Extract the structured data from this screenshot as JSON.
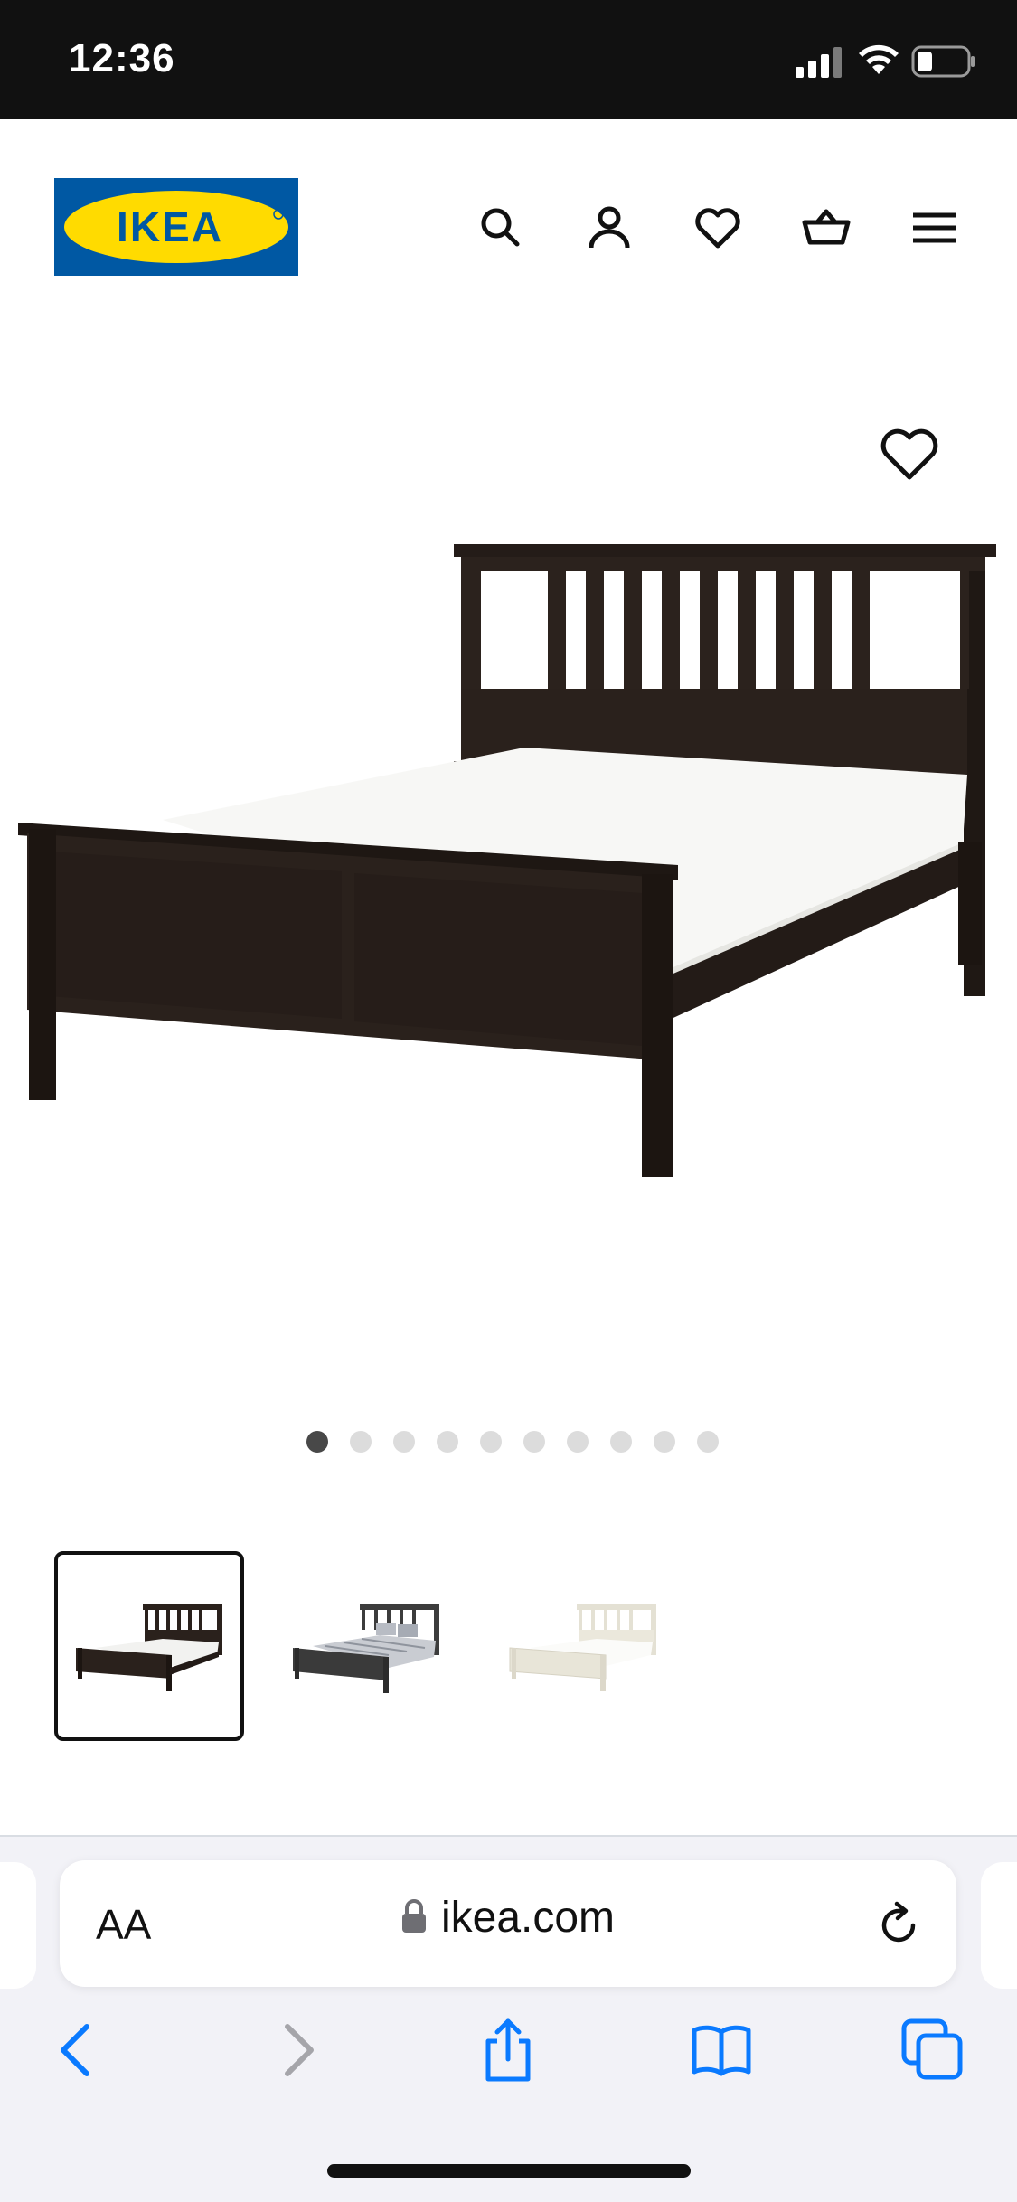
{
  "status_bar": {
    "time": "12:36",
    "icons": [
      "cellular-signal-icon",
      "wifi-icon",
      "battery-icon"
    ]
  },
  "header": {
    "logo_text": "IKEA",
    "brand_colors": {
      "blue": "#0058a3",
      "yellow": "#ffdb00"
    },
    "icons": [
      "search-icon",
      "account-icon",
      "favourites-heart-icon",
      "shopping-basket-icon",
      "menu-hamburger-icon"
    ]
  },
  "gallery": {
    "wishlist_icon": "heart-outline-icon",
    "image_count": 10,
    "active_index": 0,
    "thumbnails": [
      {
        "name": "black-brown-bed",
        "color": "#2a211c"
      },
      {
        "name": "black-brown-bed-with-bedding",
        "color": "#3c3c3c"
      },
      {
        "name": "white-bed",
        "color": "#ece9de"
      }
    ]
  },
  "browser": {
    "text_size_label": "AA",
    "url": "ikea.com",
    "accent_color": "#0a7aff",
    "toolbar_icons": [
      "back-icon",
      "forward-icon",
      "share-icon",
      "bookmarks-icon",
      "tabs-icon"
    ]
  }
}
